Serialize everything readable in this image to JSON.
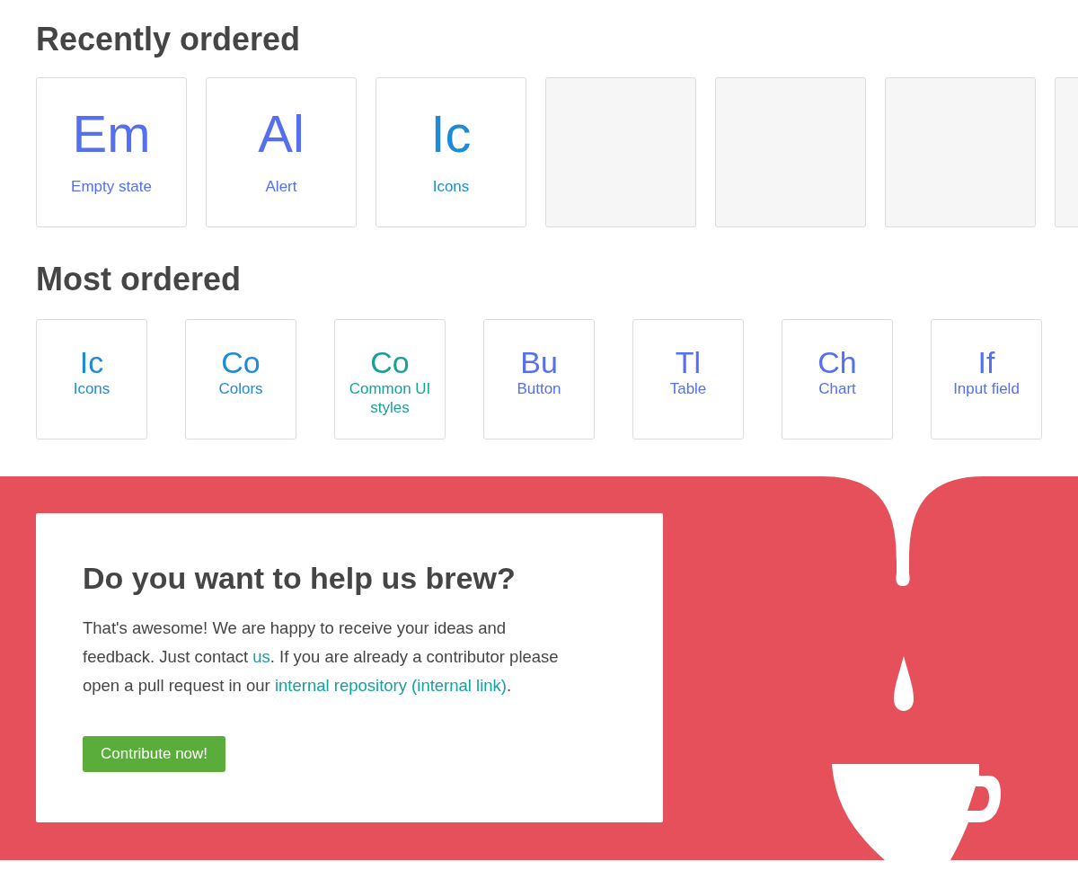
{
  "recently_ordered": {
    "title": "Recently ordered",
    "tiles": [
      {
        "kind": "component",
        "initials": "Em",
        "label": "Empty state",
        "color": "#5470f0"
      },
      {
        "kind": "component",
        "initials": "Al",
        "label": "Alert",
        "color": "#5470f0"
      },
      {
        "kind": "component",
        "initials": "Ic",
        "label": "Icons",
        "color": "#1f8bd6"
      },
      {
        "kind": "empty"
      },
      {
        "kind": "empty"
      },
      {
        "kind": "empty"
      },
      {
        "kind": "empty"
      }
    ]
  },
  "most_ordered": {
    "title": "Most ordered",
    "tiles": [
      {
        "initials": "Ic",
        "label": "Icons",
        "color": "#1f8bd6"
      },
      {
        "initials": "Co",
        "label": "Colors",
        "color": "#1f8bd6"
      },
      {
        "initials": "Co",
        "label": "Common UI styles",
        "color": "#1a9e9a"
      },
      {
        "initials": "Bu",
        "label": "Button",
        "color": "#5470f0"
      },
      {
        "initials": "Tl",
        "label": "Table",
        "color": "#5470f0"
      },
      {
        "initials": "Ch",
        "label": "Chart",
        "color": "#5470f0"
      },
      {
        "initials": "If",
        "label": "Input field",
        "color": "#5470f0"
      }
    ]
  },
  "contribute": {
    "title": "Do you want to help us brew?",
    "paragraph": [
      {
        "kind": "text",
        "text": "That's awesome! We are happy to receive your ideas and feedback. Just contact "
      },
      {
        "kind": "link",
        "text": "us"
      },
      {
        "kind": "text",
        "text": ". If you are already a contributor please open a pull request in our "
      },
      {
        "kind": "link",
        "text": "internal repository (internal link)"
      },
      {
        "kind": "text",
        "text": "."
      }
    ],
    "button": "Contribute now!"
  }
}
